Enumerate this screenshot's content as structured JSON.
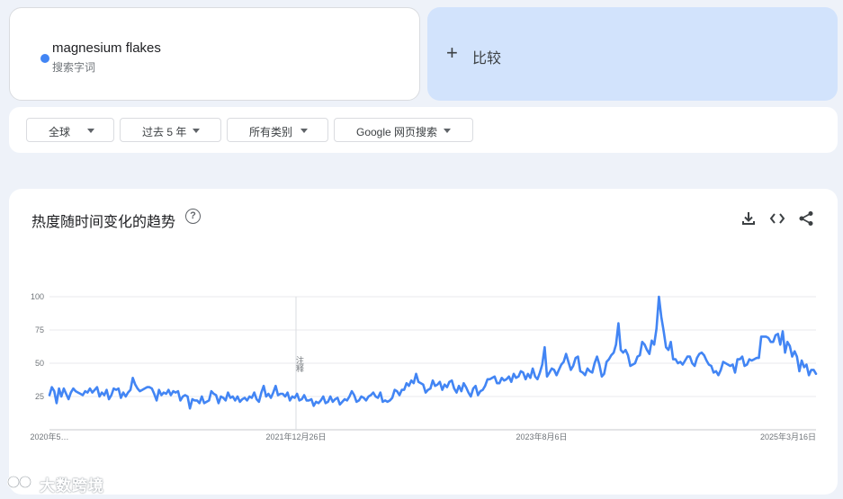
{
  "search_term": {
    "name": "magnesium flakes",
    "type": "搜索字词",
    "color": "#4285f4"
  },
  "compare": {
    "plus": "+",
    "label": "比较"
  },
  "filters": [
    {
      "label": "全球"
    },
    {
      "label": "过去 5 年"
    },
    {
      "label": "所有类别"
    },
    {
      "label": "Google 网页搜索"
    }
  ],
  "chart_section": {
    "title": "热度随时间变化的趋势",
    "help_icon": "help-circle-icon",
    "tools": [
      "download-icon",
      "embed-code-icon",
      "share-icon"
    ]
  },
  "watermark": "大数跨境",
  "chart_data": {
    "type": "line",
    "title": "",
    "xlabel": "",
    "ylabel": "",
    "ylim": [
      0,
      100
    ],
    "yticks": [
      25,
      50,
      75,
      100
    ],
    "xtick_labels": [
      "2020年5…",
      "2021年12月26日",
      "2023年8月6日",
      "2025年3月16日"
    ],
    "annotation": "注释",
    "grid": true,
    "series": [
      {
        "color": "#4285f4",
        "values": [
          26,
          32,
          29,
          20,
          31,
          25,
          31,
          27,
          23,
          28,
          31,
          29,
          28,
          27,
          26,
          29,
          28,
          31,
          28,
          30,
          32,
          25,
          28,
          26,
          30,
          23,
          26,
          31,
          30,
          31,
          24,
          28,
          25,
          28,
          30,
          39,
          34,
          31,
          29,
          30,
          31,
          32,
          32,
          31,
          27,
          22,
          30,
          26,
          28,
          27,
          30,
          26,
          29,
          28,
          29,
          22,
          25,
          26,
          25,
          16,
          23,
          22,
          22,
          20,
          25,
          20,
          21,
          22,
          29,
          27,
          26,
          20,
          25,
          24,
          22,
          28,
          24,
          25,
          22,
          25,
          21,
          23,
          24,
          22,
          25,
          24,
          28,
          23,
          21,
          28,
          33,
          25,
          27,
          24,
          28,
          33,
          26,
          27,
          27,
          25,
          28,
          22,
          25,
          24,
          27,
          22,
          23,
          26,
          22,
          22,
          23,
          18,
          21,
          20,
          22,
          25,
          20,
          21,
          25,
          21,
          23,
          24,
          19,
          21,
          23,
          22,
          25,
          29,
          26,
          21,
          22,
          25,
          24,
          22,
          25,
          26,
          28,
          25,
          24,
          28,
          21,
          22,
          21,
          22,
          24,
          30,
          29,
          26,
          30,
          30,
          35,
          33,
          37,
          35,
          42,
          36,
          35,
          34,
          28,
          30,
          31,
          37,
          33,
          34,
          36,
          30,
          34,
          32,
          36,
          37,
          31,
          28,
          33,
          29,
          35,
          32,
          28,
          25,
          31,
          33,
          26,
          29,
          30,
          33,
          38,
          38,
          39,
          40,
          35,
          35,
          39,
          37,
          38,
          40,
          36,
          42,
          39,
          40,
          44,
          43,
          38,
          42,
          39,
          46,
          40,
          38,
          43,
          49,
          62,
          40,
          43,
          46,
          45,
          41,
          45,
          49,
          51,
          57,
          51,
          45,
          48,
          54,
          55,
          44,
          43,
          41,
          46,
          44,
          43,
          50,
          55,
          49,
          40,
          42,
          51,
          53,
          56,
          58,
          64,
          80,
          60,
          58,
          60,
          56,
          48,
          49,
          50,
          55,
          56,
          66,
          64,
          60,
          57,
          67,
          64,
          76,
          100,
          85,
          74,
          62,
          60,
          66,
          53,
          53,
          50,
          51,
          49,
          52,
          55,
          55,
          50,
          48,
          54,
          57,
          58,
          56,
          52,
          49,
          48,
          43,
          44,
          41,
          45,
          51,
          50,
          49,
          48,
          49,
          43,
          53,
          53,
          55,
          48,
          49,
          53,
          52,
          53,
          54,
          54,
          70,
          70,
          70,
          69,
          66,
          66,
          71,
          72,
          64,
          74,
          58,
          66,
          63,
          55,
          59,
          55,
          44,
          52,
          47,
          49,
          41,
          45,
          45,
          42
        ]
      }
    ]
  }
}
